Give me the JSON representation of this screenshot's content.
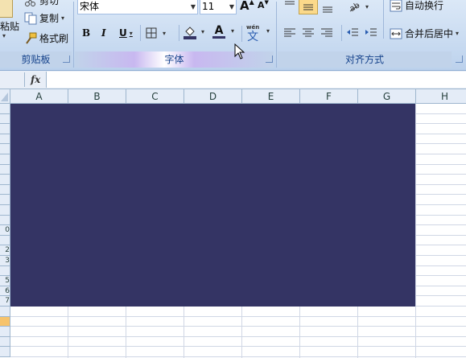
{
  "clipboard": {
    "cut_label": "剪切",
    "paste_label": "粘贴",
    "copy_label": "复制",
    "format_painter_label": "格式刷",
    "group_label": "剪贴板"
  },
  "font": {
    "name_value": "宋体",
    "size_value": "11",
    "grow_label": "A",
    "shrink_label": "A",
    "bold_label": "B",
    "italic_label": "I",
    "underline_label": "U",
    "font_color_label": "A",
    "phonetic_top": "wén",
    "phonetic_char": "文",
    "group_label": "字体"
  },
  "alignment": {
    "wrap_text_label": "自动换行",
    "merge_center_label": "合并后居中",
    "group_label": "对齐方式"
  },
  "formula_bar": {
    "fx_label": "fx",
    "value": ""
  },
  "sheet": {
    "columns": [
      "A",
      "B",
      "C",
      "D",
      "E",
      "F",
      "G",
      "H"
    ],
    "row_labels": [
      "",
      "",
      "",
      "",
      "",
      "",
      "",
      "",
      "",
      "",
      "0",
      "",
      "2",
      "3",
      "",
      "5",
      "6",
      "7"
    ],
    "fill_color": "#343464",
    "selected_row_color": "#f6c36c"
  },
  "colors": {
    "ribbon_bg": "#c6d9f0",
    "accent": "#15428b"
  }
}
